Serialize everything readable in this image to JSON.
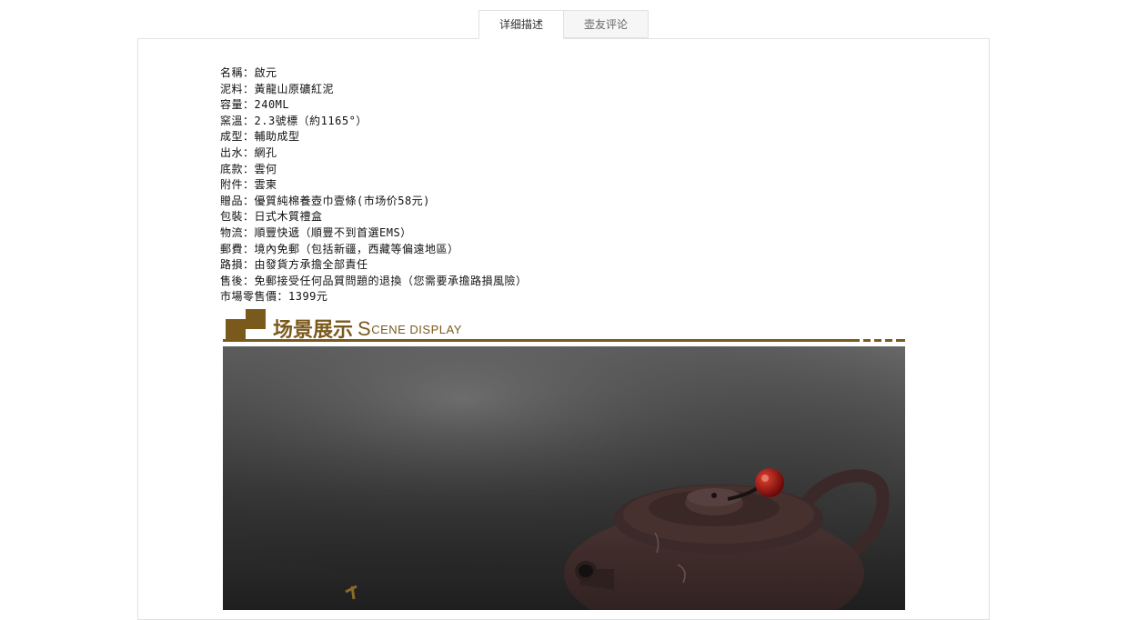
{
  "tabs": [
    {
      "label": "详细描述",
      "active": true
    },
    {
      "label": "壶友评论",
      "active": false
    }
  ],
  "specs": [
    "名稱：啟元",
    "泥料：黃龍山原礦紅泥",
    "容量：240ML",
    "窯溫：2.3號標（約1165°）",
    "成型：輔助成型",
    "出水：網孔",
    "底款：雲何",
    "附件：雲柬",
    "贈品：優質純棉養壺巾壹條(市场价58元)",
    "包裝：日式木質禮盒",
    "物流：順豐快遞（順豐不到首選EMS）",
    "郵費：境內免郵（包括新疆，西藏等偏遠地區）",
    "路損：由發貨方承擔全部責任",
    "售後：免郵接受任何品質問題的退換（您需要承擔路損風險）",
    "市場零售價：1399元"
  ],
  "banner": {
    "title": "场景展示",
    "subtitle_initial": "S",
    "subtitle_rest": "CENE DISPLAY",
    "color": "#7a5a1c"
  },
  "scene_image": {
    "subject": "purple clay teapot with red bead lid knob on dark background"
  }
}
